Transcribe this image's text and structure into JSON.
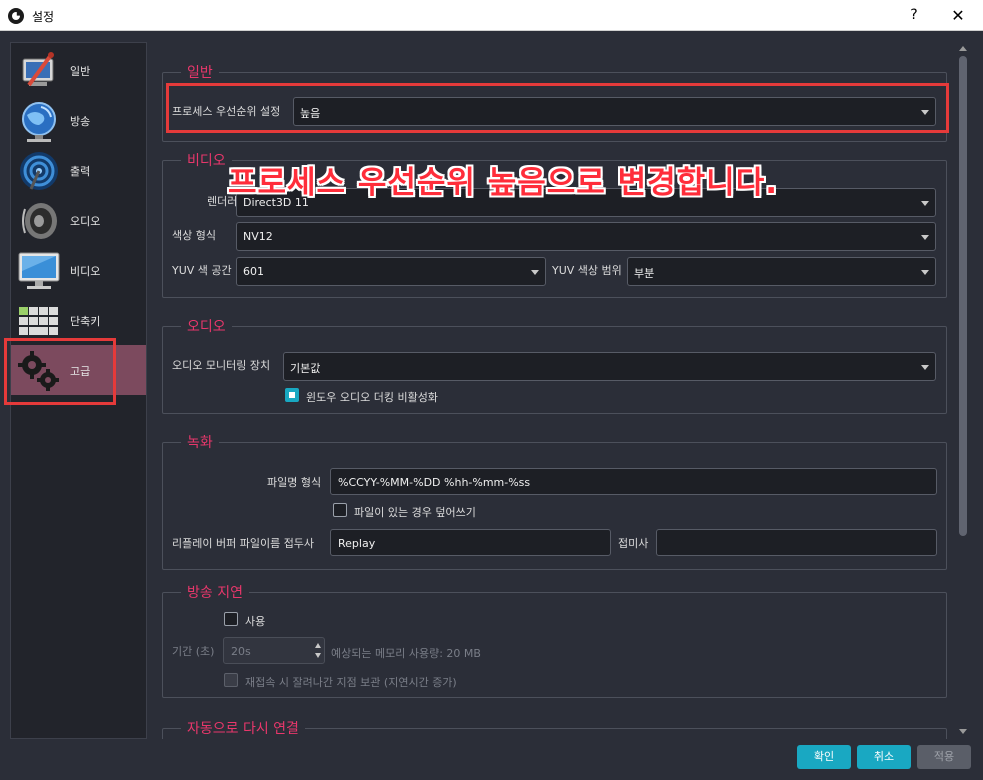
{
  "window": {
    "title": "설정",
    "help": "?",
    "close": "✕"
  },
  "sidebar": {
    "items": [
      {
        "label": "일반",
        "icon": "general-icon"
      },
      {
        "label": "방송",
        "icon": "globe-icon"
      },
      {
        "label": "출력",
        "icon": "output-icon"
      },
      {
        "label": "오디오",
        "icon": "speaker-icon"
      },
      {
        "label": "비디오",
        "icon": "monitor-icon"
      },
      {
        "label": "단축키",
        "icon": "keyboard-icon"
      },
      {
        "label": "고급",
        "icon": "gears-icon"
      }
    ],
    "active": "고급"
  },
  "general": {
    "title": "일반",
    "priority_label": "프로세스 우선순위 설정",
    "priority_value": "높음"
  },
  "video": {
    "title": "비디오",
    "renderer_label": "렌더러",
    "renderer_value": "Direct3D 11",
    "color_format_label": "색상 형식",
    "color_format_value": "NV12",
    "color_space_label": "YUV 색 공간",
    "color_space_value": "601",
    "color_range_label": "YUV 색상 범위",
    "color_range_value": "부분"
  },
  "audio": {
    "title": "오디오",
    "monitor_label": "오디오 모니터링 장치",
    "monitor_value": "기본값",
    "ducking_label": "윈도우 오디오 더킹 비활성화",
    "ducking_checked": true
  },
  "recording": {
    "title": "녹화",
    "filename_label": "파일명 형식",
    "filename_value": "%CCYY-%MM-%DD %hh-%mm-%ss",
    "overwrite_label": "파일이 있는 경우 덮어쓰기",
    "overwrite_checked": false,
    "replay_prefix_label": "리플레이 버퍼 파일이름 접두사",
    "replay_prefix_value": "Replay",
    "suffix_label": "접미사",
    "suffix_value": ""
  },
  "stream_delay": {
    "title": "방송 지연",
    "enable_label": "사용",
    "duration_label": "기간 (초)",
    "duration_value": "20s",
    "memory_text": "예상되는 메모리 사용량: 20 MB",
    "preserve_label": "재접속 시 잘려나간 지점 보관 (지연시간 증가)"
  },
  "reconnect": {
    "title": "자동으로 다시 연결"
  },
  "annotation": {
    "text": "프로세스 우선순위 높음으로 변경합니다."
  },
  "buttons": {
    "ok": "확인",
    "cancel": "취소",
    "apply": "적용"
  },
  "colors": {
    "accent": "#19a8c2",
    "group_title": "#e8376b",
    "highlight": "#e53a3a",
    "sidebar_active": "#7c4a5e"
  }
}
